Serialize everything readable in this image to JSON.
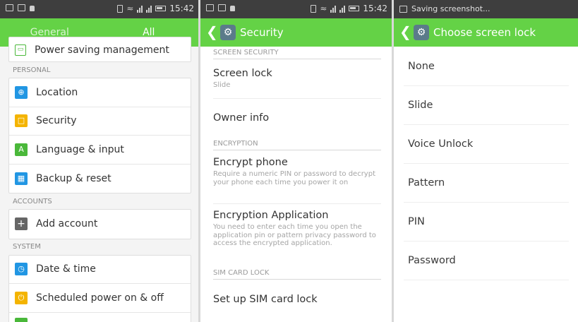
{
  "colors": {
    "accent": "#64d246",
    "status_bar": "#3e3e3e"
  },
  "panel1": {
    "status": {
      "time": "15:42"
    },
    "tabs": [
      {
        "label": "General"
      },
      {
        "label": "All"
      }
    ],
    "top_item": {
      "label": "Power saving management",
      "icon": "battery-saver-icon"
    },
    "sections": {
      "personal": "PERSONAL",
      "accounts": "ACCOUNTS",
      "system": "SYSTEM"
    },
    "personal_items": [
      {
        "label": "Location",
        "icon": "location-icon",
        "color": "#2196e3"
      },
      {
        "label": "Security",
        "icon": "lock-icon",
        "color": "#f4b400"
      },
      {
        "label": "Language & input",
        "icon": "language-icon",
        "color": "#4ab83a"
      },
      {
        "label": "Backup & reset",
        "icon": "backup-icon",
        "color": "#2196e3"
      }
    ],
    "account_items": [
      {
        "label": "Add account",
        "icon": "plus-icon",
        "color": "#666666"
      }
    ],
    "system_items": [
      {
        "label": "Date & time",
        "icon": "clock-icon",
        "color": "#2196e3"
      },
      {
        "label": "Scheduled power on & off",
        "icon": "power-icon",
        "color": "#f4b400"
      }
    ]
  },
  "panel2": {
    "status": {
      "time": "15:42"
    },
    "title": "Security",
    "sections": {
      "screen_security": "SCREEN SECURITY",
      "encryption": "ENCRYPTION",
      "sim_card_lock": "SIM CARD LOCK"
    },
    "screen_lock": {
      "title": "Screen lock",
      "summary": "Slide"
    },
    "owner_info": {
      "title": "Owner info"
    },
    "encrypt_phone": {
      "title": "Encrypt phone",
      "summary": "Require a numeric PIN or password to decrypt your phone each time you power it on"
    },
    "encryption_app": {
      "title": "Encryption Application",
      "summary": "You need to enter each time you open the application pin or pattern privacy password to access the encrypted application."
    },
    "sim_lock": {
      "title": "Set up SIM card lock"
    }
  },
  "panel3": {
    "status": {
      "text": "Saving screenshot..."
    },
    "title": "Choose screen lock",
    "options": [
      "None",
      "Slide",
      "Voice Unlock",
      "Pattern",
      "PIN",
      "Password"
    ]
  }
}
